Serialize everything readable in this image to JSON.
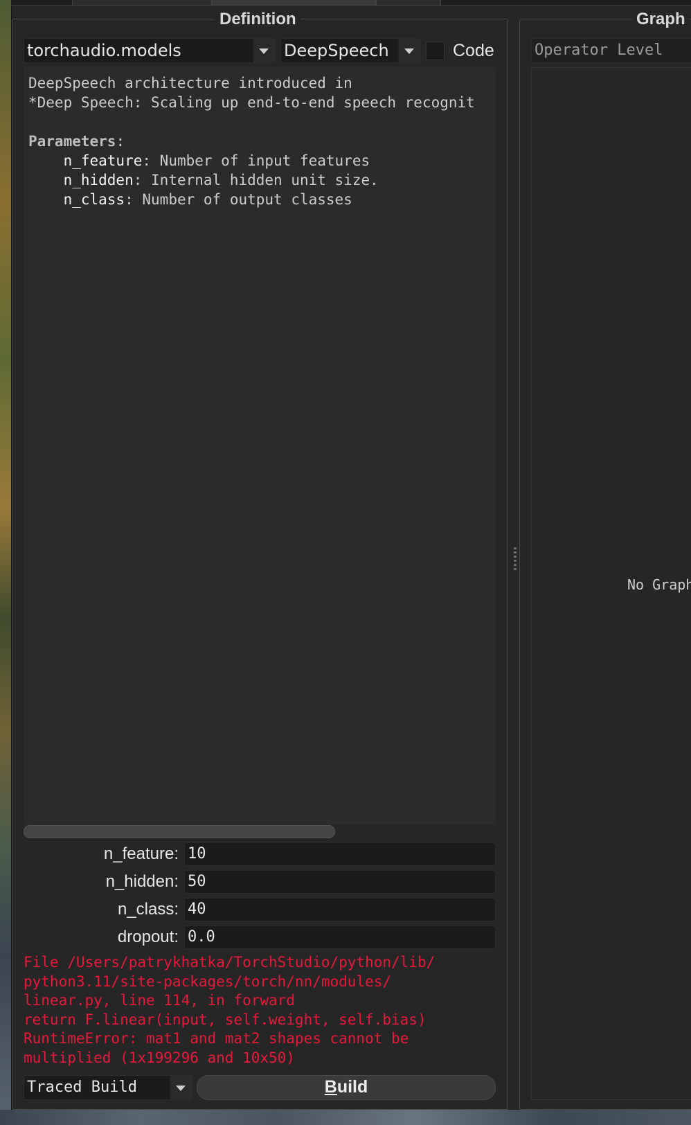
{
  "definition_panel": {
    "title": "Definition",
    "module_select": "torchaudio.models",
    "model_select": "DeepSpeech",
    "code_label": "Code",
    "doc": {
      "intro_line1": "DeepSpeech architecture introduced in",
      "intro_line2": "*Deep Speech: Scaling up end-to-end speech recognit",
      "params_header": "Parameters",
      "params": [
        {
          "name": "n_feature",
          "desc": "Number of input features"
        },
        {
          "name": "n_hidden",
          "desc": "Internal hidden unit size."
        },
        {
          "name": "n_class",
          "desc": "Number of output classes"
        }
      ]
    },
    "form": [
      {
        "label": "n_feature:",
        "value": "10"
      },
      {
        "label": "n_hidden:",
        "value": "50"
      },
      {
        "label": "n_class:",
        "value": "40"
      },
      {
        "label": "dropout:",
        "value": "0.0"
      }
    ],
    "error_lines": [
      "File /Users/patrykhatka/TorchStudio/python/lib/",
      "python3.11/site-packages/torch/nn/modules/",
      "linear.py, line 114, in forward",
      "return F.linear(input, self.weight, self.bias)",
      "RuntimeError: mat1 and mat2 shapes cannot be",
      "multiplied (1x199296 and 10x50)"
    ],
    "build_mode": "Traced Build",
    "build_button": {
      "mnemonic": "B",
      "rest": "uild"
    }
  },
  "graph_panel": {
    "title": "Graph",
    "level_select": "Operator Level",
    "empty_text": "No Graph"
  },
  "colors": {
    "background": "#262626",
    "error": "#e8183a",
    "text": "#e6e6e6"
  }
}
